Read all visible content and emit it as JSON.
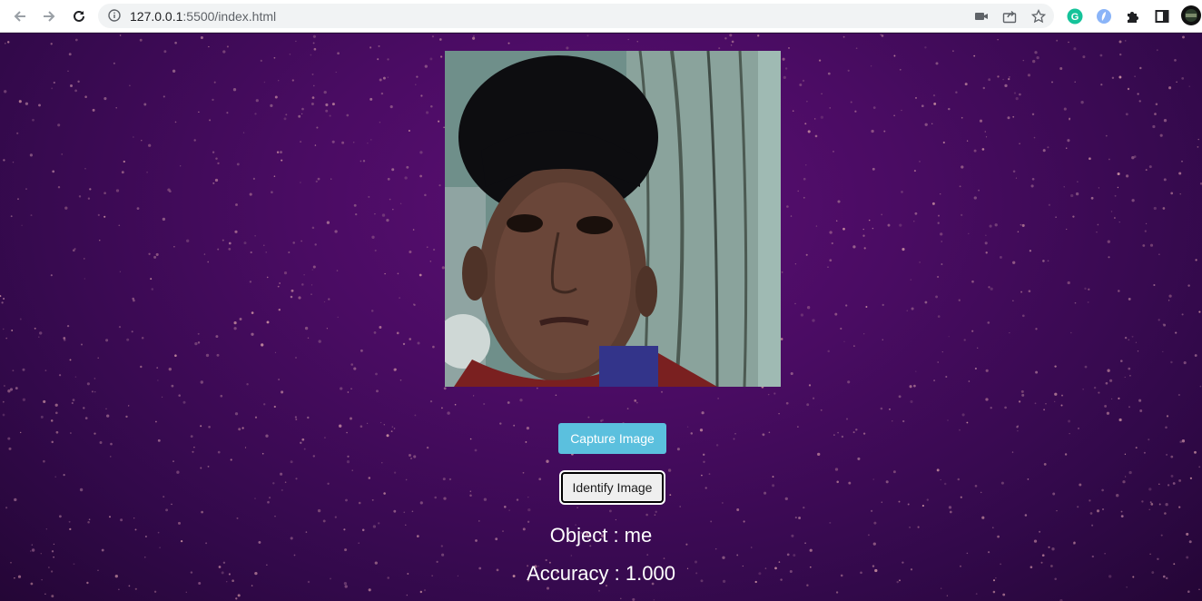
{
  "browser": {
    "url_host": "127.0.0.1",
    "url_rest": ":5500/index.html",
    "icons": [
      "back-icon",
      "forward-icon",
      "reload-icon",
      "site-info-icon",
      "camera-icon",
      "share-icon",
      "bookmark-star-icon",
      "grammarly-icon",
      "extension-icon",
      "puzzle-icon",
      "side-panel-icon",
      "profile-avatar"
    ]
  },
  "page": {
    "capture_label": "Capture Image",
    "identify_label": "Identify Image",
    "object_text": "Object : me",
    "accuracy_text": "Accuracy : 1.000"
  },
  "colors": {
    "background": "#4a0c63",
    "capture_button": "#5bc0de",
    "identify_button": "#efefef"
  }
}
